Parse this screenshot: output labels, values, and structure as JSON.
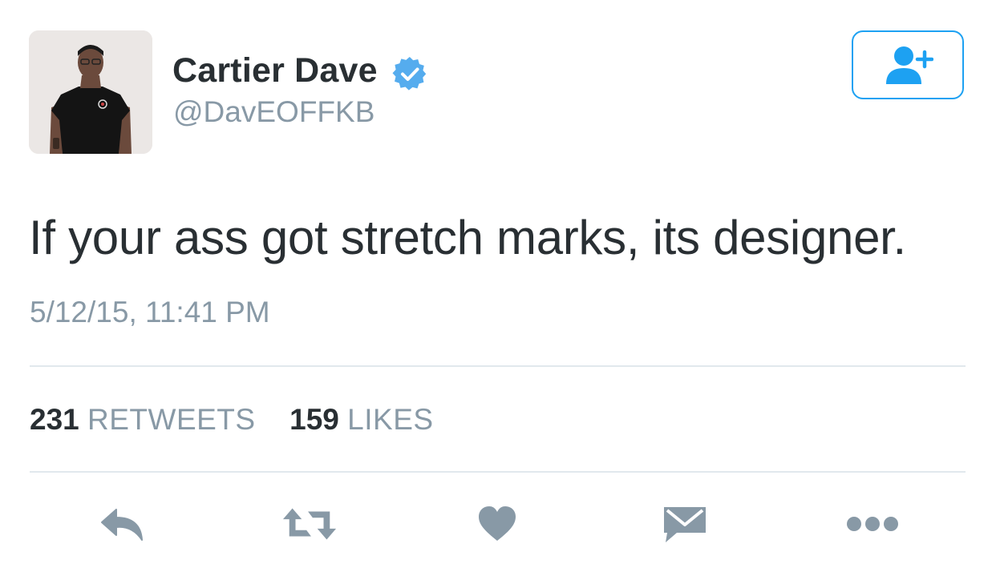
{
  "tweet": {
    "author": {
      "display_name": "Cartier Dave",
      "handle": "@DavEOFFKB",
      "verified": true,
      "avatar_icon": "profile-photo"
    },
    "text": "If your ass got stretch marks, its designer.",
    "timestamp": "5/12/15, 11:41 PM",
    "stats": {
      "retweets_count": "231",
      "retweets_label": "RETWEETS",
      "likes_count": "159",
      "likes_label": "LIKES"
    }
  },
  "actions": [
    {
      "name": "reply",
      "icon": "reply-icon"
    },
    {
      "name": "retweet",
      "icon": "retweet-icon"
    },
    {
      "name": "like",
      "icon": "heart-icon"
    },
    {
      "name": "direct-message",
      "icon": "envelope-icon"
    },
    {
      "name": "more",
      "icon": "more-dots-icon"
    }
  ],
  "colors": {
    "accent": "#1da1f2",
    "text_primary": "#292f33",
    "text_secondary": "#8899a6",
    "icon_gray": "#8899a6",
    "divider": "#e1e8ed"
  }
}
